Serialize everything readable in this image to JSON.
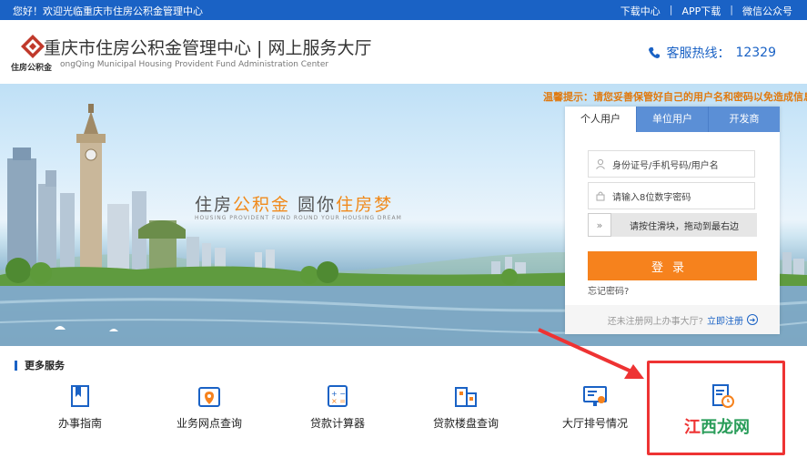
{
  "topbar": {
    "welcome": "您好！欢迎光临重庆市住房公积金管理中心",
    "links": [
      "下载中心",
      "APP下载",
      "微信公众号"
    ],
    "separator": "|"
  },
  "header": {
    "logo_sub": "住房公积金",
    "title": "重庆市住房公积金管理中心 | 网上服务大厅",
    "subtitle_en": "ongQing Municipal Housing Provident Fund Administration Center",
    "hotline_label": "客服热线：",
    "hotline_number": "12329"
  },
  "banner": {
    "notice": "温馨提示：请您妥善保管好自己的用户名和密码以免造成信息泄",
    "slogan_a": "住房",
    "slogan_b": "公积金",
    "slogan_c": "圆你",
    "slogan_d": "住房梦",
    "slogan_en": "HOUSING PROVIDENT FUND ROUND YOUR HOUSING DREAM"
  },
  "login": {
    "tabs": [
      "个人用户",
      "单位用户",
      "开发商"
    ],
    "username_placeholder": "身份证号/手机号码/用户名",
    "password_placeholder": "请输入8位数字密码",
    "slider_text": "请按住滑块，拖动到最右边",
    "submit_label": "登录",
    "forgot": "忘记密码?",
    "register_prompt": "还未注册网上办事大厅?",
    "register_link": "立即注册"
  },
  "more_services": {
    "title": "更多服务",
    "items": [
      {
        "label": "办事指南",
        "icon": "book-icon"
      },
      {
        "label": "业务网点查询",
        "icon": "location-icon"
      },
      {
        "label": "贷款计算器",
        "icon": "calculator-icon"
      },
      {
        "label": "贷款楼盘查询",
        "icon": "building-icon"
      },
      {
        "label": "大厅排号情况",
        "icon": "queue-screen-icon"
      },
      {
        "label": "",
        "icon": "document-clock-icon"
      }
    ]
  },
  "watermark": {
    "a": "江",
    "b": "西龙网"
  },
  "colors": {
    "primary": "#1a62c5",
    "accent": "#f6821d",
    "highlight": "#e33333"
  }
}
